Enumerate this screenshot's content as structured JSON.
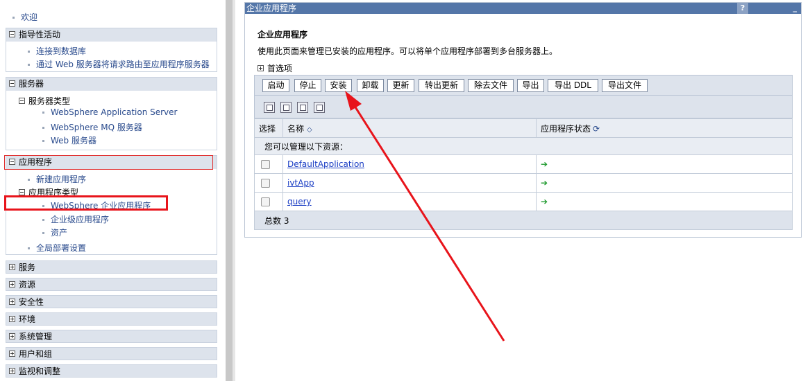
{
  "nav": {
    "welcome": "欢迎",
    "guided": {
      "title": "指导性活动",
      "items": [
        "连接到数据库",
        "通过 Web 服务器将请求路由至应用程序服务器"
      ]
    },
    "servers": {
      "title": "服务器",
      "sub_title": "服务器类型",
      "items": [
        "WebSphere Application Server",
        "WebSphere MQ 服务器",
        "Web 服务器"
      ]
    },
    "applications": {
      "title": "应用程序",
      "new_app": "新建应用程序",
      "types_title": "应用程序类型",
      "types": [
        "WebSphere 企业应用程序",
        "企业级应用程序",
        "资产"
      ],
      "global": "全局部署设置"
    },
    "collapsed": [
      "服务",
      "资源",
      "安全性",
      "环境",
      "系统管理",
      "用户和组",
      "监视和调整"
    ]
  },
  "panel": {
    "titlebar": "企业应用程序",
    "help_label": "?",
    "min_label": "_",
    "title": "企业应用程序",
    "description": "使用此页面来管理已安装的应用程序。可以将单个应用程序部署到多台服务器上。",
    "preferences": "首选项",
    "buttons": [
      "启动",
      "停止",
      "安装",
      "卸载",
      "更新",
      "转出更新",
      "除去文件",
      "导出",
      "导出 DDL",
      "导出文件"
    ],
    "table": {
      "headers": [
        "选择",
        "名称",
        "应用程序状态"
      ],
      "info": "您可以管理以下资源：",
      "rows": [
        "DefaultApplication",
        "ivtApp",
        "query"
      ],
      "total": "总数 3"
    }
  },
  "colors": {
    "nav_link": "#2a4b8d",
    "titlebar": "#5476a8",
    "annotation": "#e8141b",
    "status_running": "#1f9a2e"
  },
  "icons": [
    "plus-minus-icon",
    "select-all-icon",
    "deselect-all-icon",
    "expand-all-icon",
    "filter-icon",
    "sort-icon",
    "refresh-icon",
    "status-started-icon"
  ]
}
